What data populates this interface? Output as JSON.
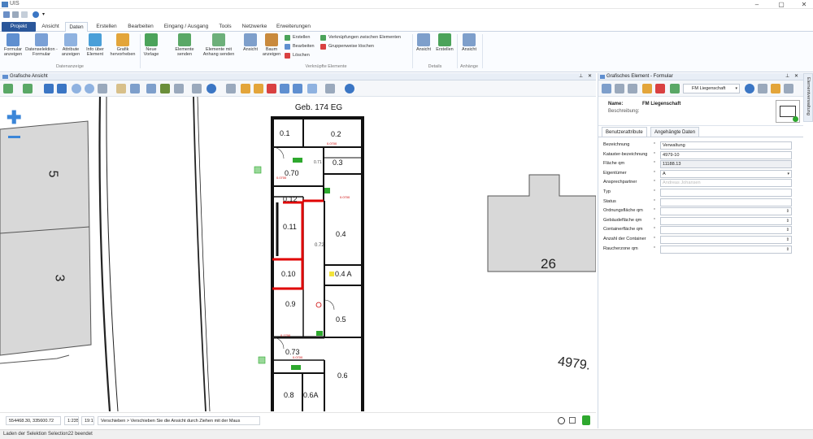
{
  "window": {
    "title": "UIS"
  },
  "ribbon_tabs": {
    "file": "Projekt",
    "items": [
      "Ansicht",
      "Daten",
      "Erstellen",
      "Bearbeiten",
      "Eingang / Ausgang",
      "Tools",
      "Netzwerke",
      "Erweiterungen"
    ],
    "active": "Daten"
  },
  "ribbon": {
    "btn_formular": "Formular anzeigen",
    "btn_datenselektion": "Datenselektion - Formular",
    "btn_attribute": "Attribute anzeigen",
    "btn_info": "Info über Element",
    "btn_grafik": "Grafik hervorheben",
    "grp_datenanzeige": "Datenanzeige",
    "btn_neue_vorlage": "Neue Vorlage",
    "btn_elemente_senden": "Elemente senden",
    "btn_elemente_anhang": "Elemente mit Anhang senden",
    "btn_ansicht": "Ansicht",
    "btn_baum": "Baum anzeigen",
    "small_erstellen": "Erstellen",
    "small_bearbeiten": "Bearbeiten",
    "small_loeschen": "Löschen",
    "small_verkn": "Verknüpfungen zwischen Elementen",
    "small_gruppen": "Gruppenweise löschen",
    "grp_verknuepfte": "Verknüpfte Elemente",
    "btn_details_ansicht": "Ansicht",
    "btn_details_erstellen": "Erstellen",
    "grp_details": "Details",
    "btn_anhaenge_ansicht": "Ansicht",
    "grp_anhaenge": "Anhänge"
  },
  "graphic_view": {
    "header": "Grafische Ansicht",
    "building_title": "Geb. 174 EG",
    "rooms": [
      "0.1",
      "0.2",
      "0.70",
      "0.3",
      "0.12",
      "0.11",
      "0.4",
      "0.10",
      "0.4 A",
      "0.9",
      "0.5",
      "0.73",
      "0.6",
      "0.8",
      "0.6A"
    ],
    "corridor_labels": [
      "0.72",
      "0.71"
    ],
    "parcel_labels": [
      "5",
      "3",
      "26",
      "4979."
    ],
    "coordinates": "554468.30, 335600.72",
    "scale": "1:235",
    "zoom": "19:1",
    "hint": "Verschieben > Verschieben Sie die Ansicht durch Ziehen mit der Maus"
  },
  "status_bar": {
    "text": "Laden der Selektion Selection22 beendet"
  },
  "right_panel": {
    "header": "Grafisches Element - Formular",
    "selector": "FM Liegenschaft",
    "name_label": "Name:",
    "name_value": "FM Liegenschaft",
    "desc_label": "Beschreibung:",
    "tabs": [
      "Benutzerattribute",
      "Angehängte Daten"
    ],
    "side_tab": "Elementverwaltung",
    "fields": [
      {
        "label": "Bezeichnung",
        "value": "Verwaltung"
      },
      {
        "label": "Kataster-bezeichnung",
        "value": "4979-10"
      },
      {
        "label": "Fläche qm",
        "value": "11188.13"
      },
      {
        "label": "Eigentümer",
        "value": "A"
      },
      {
        "label": "Ansprechpartner",
        "value": "Andreas Johansen"
      },
      {
        "label": "Typ",
        "value": ""
      },
      {
        "label": "Status",
        "value": ""
      },
      {
        "label": "Ordnungsfläche qm",
        "value": ""
      },
      {
        "label": "Gebäudefläche qm",
        "value": ""
      },
      {
        "label": "Containerfläche qm",
        "value": ""
      },
      {
        "label": "Anzahl der Container",
        "value": ""
      },
      {
        "label": "Raucherzone qm",
        "value": ""
      }
    ]
  },
  "colors": {
    "accent": "#2b579a",
    "wall": "#111111",
    "red_path": "#e00000",
    "green_marker": "#2ea82e",
    "parcel_fill": "#d8d8d8"
  }
}
